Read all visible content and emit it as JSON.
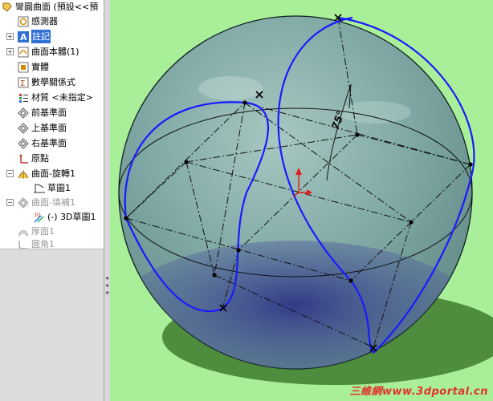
{
  "feature_tree": {
    "root": {
      "label": "彎圓曲面 (預設<<預"
    },
    "items": [
      {
        "label": "感測器"
      },
      {
        "label": "註記"
      },
      {
        "label": "曲面本體(1)"
      },
      {
        "label": "實體"
      },
      {
        "label": "數學關係式"
      },
      {
        "label": "材質 <未指定>"
      },
      {
        "label": "前基準面"
      },
      {
        "label": "上基準面"
      },
      {
        "label": "右基準面"
      },
      {
        "label": "原點"
      },
      {
        "label": "曲面-旋轉1"
      },
      {
        "label": "草圖1"
      },
      {
        "label": "曲面-填補1"
      },
      {
        "label": "(-) 3D草圖1"
      },
      {
        "label": "厚面1"
      },
      {
        "label": "圓角1"
      }
    ]
  },
  "viewport": {
    "dimension_label": "75°",
    "background_color": "#a9ee98",
    "curve_color": "#1a1aff"
  },
  "watermark": {
    "text": "三維網www.3dportal.cn"
  }
}
